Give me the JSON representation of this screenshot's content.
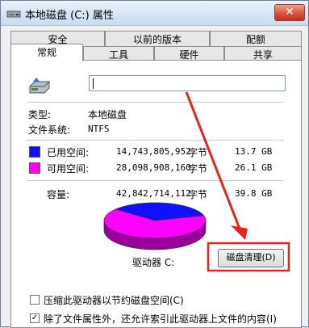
{
  "window": {
    "title": "本地磁盘 (C:) 属性",
    "close_glyph": "✕"
  },
  "tabs_row1": [
    "安全",
    "以前的版本",
    "配额"
  ],
  "tabs_row2": [
    "常规",
    "工具",
    "硬件",
    "共享"
  ],
  "general": {
    "drive_name_value": "",
    "type_label": "类型:",
    "type_value": "本地磁盘",
    "fs_label": "文件系统:",
    "fs_value": "NTFS",
    "used_label": "已用空间:",
    "used_bytes": "14,743,805,952",
    "used_unit": "字节",
    "used_size": "13.7 GB",
    "free_label": "可用空间:",
    "free_bytes": "28,098,908,160",
    "free_unit": "字节",
    "free_size": "26.1 GB",
    "capacity_label": "容量:",
    "capacity_bytes": "42,842,714,112",
    "capacity_unit": "字节",
    "capacity_size": "39.8 GB",
    "drive_label": "驱动器 C:",
    "cleanup_button": "磁盘清理(D)",
    "compress_label": "压缩此驱动器以节约磁盘空间(C)",
    "compress_checked": false,
    "index_label": "除了文件属性外，还允许索引此驱动器上文件的内容(I)",
    "index_checked": true,
    "used_fraction": 0.344,
    "colors": {
      "used": "#1010ff",
      "free": "#ff00ff",
      "annotation": "#e8231c"
    }
  }
}
